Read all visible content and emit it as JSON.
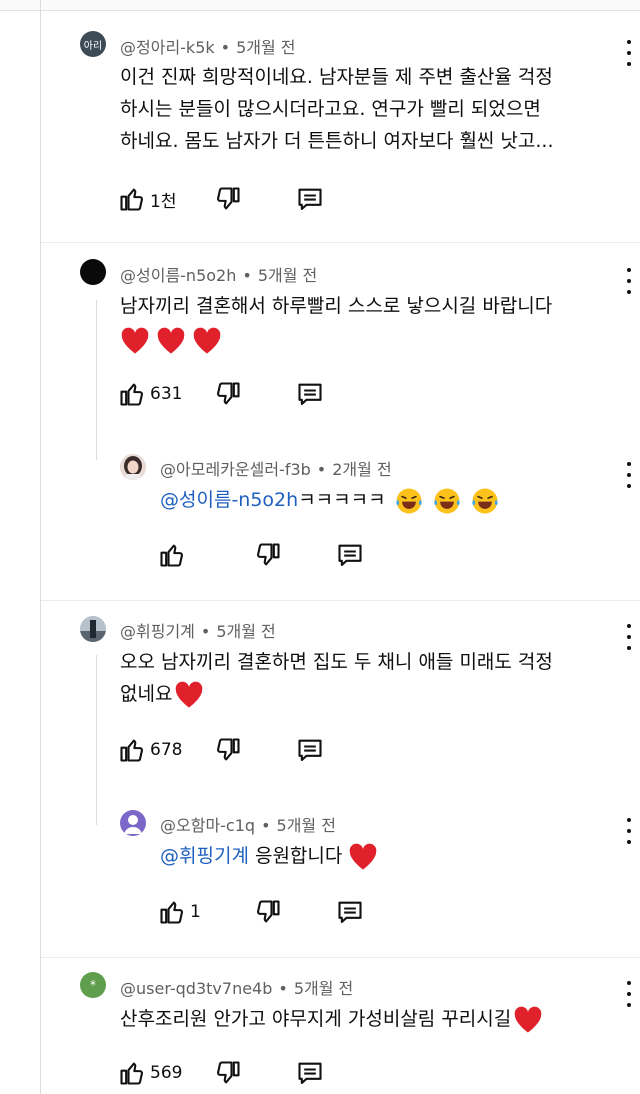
{
  "comments": [
    {
      "avatar_text": "아리",
      "handle": "@정아리-k5k",
      "time": "5개월 전",
      "lines": [
        "이건 진짜 희망적이네요. 남자분들 제 주변 출산율 걱정",
        "하시는 분들이 많으시더라고요. 연구가 빨리 되었으면",
        "하네요. 몸도 남자가 더 튼튼하니 여자보다 훨씬 낫고..."
      ],
      "likes": "1천"
    },
    {
      "handle": "@성이름-n5o2h",
      "time": "5개월 전",
      "lines": [
        "남자끼리 결혼해서 하루빨리 스스로 낳으시길 바랍니다"
      ],
      "likes": "631"
    },
    {
      "handle": "@아모레카운셀러-f3b",
      "time": "2개월 전",
      "mention": "@성이름-n5o2h",
      "text": "ㅋㅋㅋㅋㅋ",
      "likes": ""
    },
    {
      "handle": "@휘핑기계",
      "time": "5개월 전",
      "lines": [
        "오오 남자끼리 결혼하면 집도 두 채니 애들 미래도 걱정",
        "없네요"
      ],
      "likes": "678"
    },
    {
      "handle": "@오함마-c1q",
      "time": "5개월 전",
      "mention": "@휘핑기계",
      "text": " 응원합니다 ",
      "likes": "1"
    },
    {
      "avatar_text": "*",
      "handle": "@user-qd3tv7ne4b",
      "time": "5개월 전",
      "lines": [
        "산후조리원 안가고 야무지게 가성비살림 꾸리시길"
      ],
      "likes": "569"
    }
  ],
  "colors": {
    "heart": "#e0212b",
    "mention": "#1f5fbf",
    "green_avatar": "#5e9e4c",
    "purple_avatar": "#7a67c7"
  }
}
